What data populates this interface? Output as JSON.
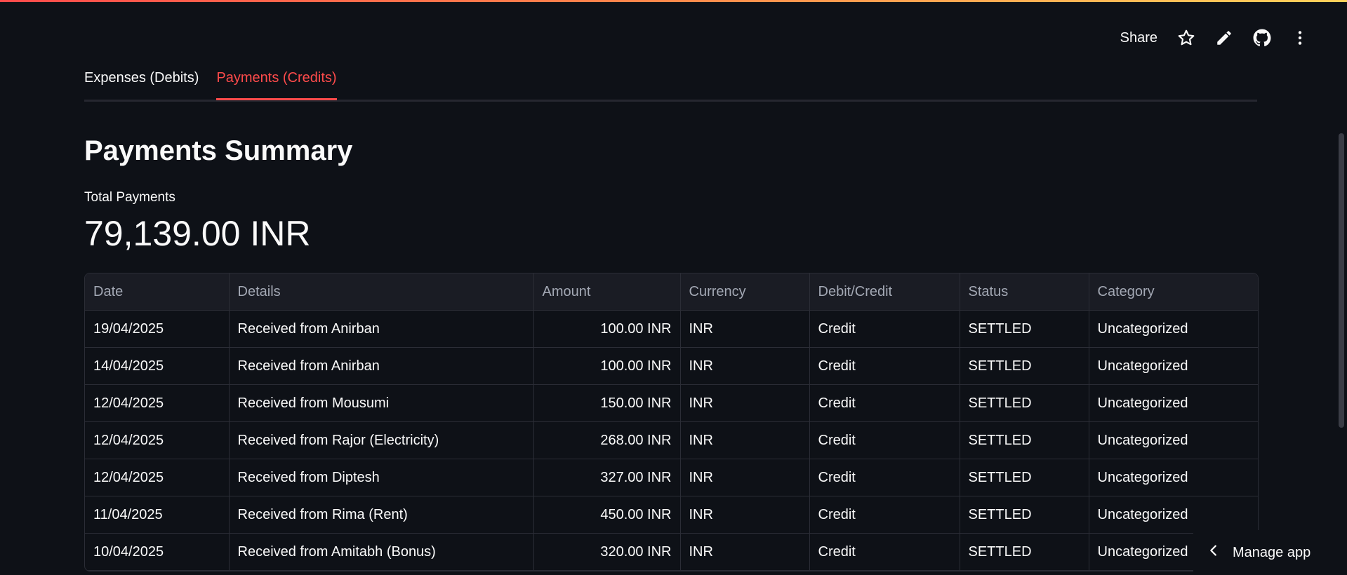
{
  "header": {
    "share_label": "Share",
    "icons": [
      "star-icon",
      "pencil-icon",
      "github-icon",
      "more-vertical-icon"
    ]
  },
  "tabs": [
    {
      "label": "Expenses (Debits)",
      "active": false
    },
    {
      "label": "Payments (Credits)",
      "active": true
    }
  ],
  "page": {
    "title": "Payments Summary",
    "metric_label": "Total Payments",
    "metric_value": "79,139.00 INR"
  },
  "table": {
    "columns": [
      "Date",
      "Details",
      "Amount",
      "Currency",
      "Debit/Credit",
      "Status",
      "Category"
    ],
    "rows": [
      [
        "19/04/2025",
        "Received from Anirban",
        "100.00 INR",
        "INR",
        "Credit",
        "SETTLED",
        "Uncategorized"
      ],
      [
        "14/04/2025",
        "Received from Anirban",
        "100.00 INR",
        "INR",
        "Credit",
        "SETTLED",
        "Uncategorized"
      ],
      [
        "12/04/2025",
        "Received from Mousumi",
        "150.00 INR",
        "INR",
        "Credit",
        "SETTLED",
        "Uncategorized"
      ],
      [
        "12/04/2025",
        "Received from Rajor (Electricity)",
        "268.00 INR",
        "INR",
        "Credit",
        "SETTLED",
        "Uncategorized"
      ],
      [
        "12/04/2025",
        "Received from Diptesh",
        "327.00 INR",
        "INR",
        "Credit",
        "SETTLED",
        "Uncategorized"
      ],
      [
        "11/04/2025",
        "Received from Rima (Rent)",
        "450.00 INR",
        "INR",
        "Credit",
        "SETTLED",
        "Uncategorized"
      ],
      [
        "10/04/2025",
        "Received from Amitabh (Bonus)",
        "320.00 INR",
        "INR",
        "Credit",
        "SETTLED",
        "Uncategorized"
      ]
    ]
  },
  "footer": {
    "manage_label": "Manage app"
  },
  "colors": {
    "accent": "#ff4b4b",
    "background": "#0e1117"
  }
}
